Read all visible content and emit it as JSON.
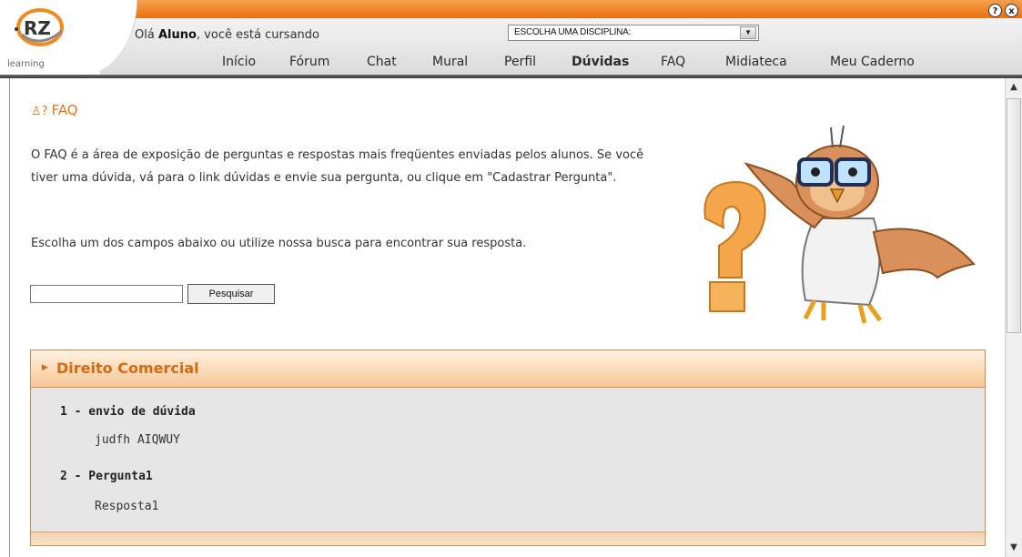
{
  "header": {
    "logo_learning": "learning",
    "greeting_prefix": "Olá ",
    "greeting_user": "Aluno",
    "greeting_suffix": ", você está cursando",
    "discipline_select": "ESCOLHA UMA DISCIPLINA:",
    "help_icon": "?",
    "close_icon": "x"
  },
  "nav": {
    "items": [
      "Início",
      "Fórum",
      "Chat",
      "Mural",
      "Perfil",
      "Dúvidas",
      "FAQ",
      "Midiateca",
      "Meu Caderno"
    ],
    "active": "Dúvidas"
  },
  "faq": {
    "title": "FAQ",
    "intro": "O FAQ é a área de exposição de perguntas e respostas mais freqüentes enviadas pelos alunos. Se você tiver uma dúvida, vá para o link dúvidas e envie sua pergunta, ou clique em \"Cadastrar Pergunta\".",
    "instruction": "Escolha um dos campos abaixo ou utilize nossa busca para encontrar sua resposta.",
    "search_value": "",
    "search_button": "Pesquisar"
  },
  "category": {
    "title": "Direito Comercial",
    "questions": [
      {
        "label": "1 - envio de dúvida",
        "answer": "judfh AIQWUY"
      },
      {
        "label": "2 - Pergunta1",
        "answer": "Resposta1"
      }
    ]
  },
  "colors": {
    "accent_orange": "#e07a1b",
    "header_orange": "#e8700f",
    "panel_bg": "#e6e6e6"
  },
  "icons": {
    "faq_icon": "question-person-icon",
    "owl": "owl-mascot-illustration"
  }
}
